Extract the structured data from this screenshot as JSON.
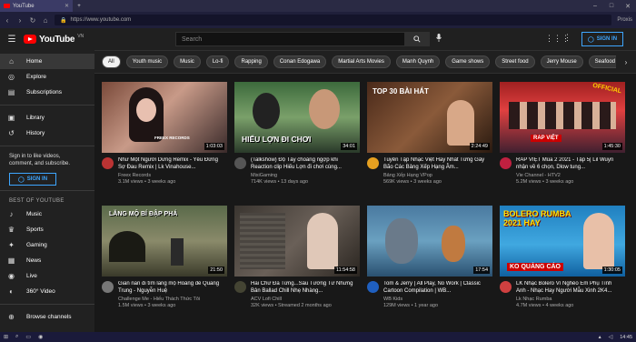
{
  "browser": {
    "tab_title": "YouTube",
    "url": "https://www.youtube.com",
    "extension_label": "Proxis"
  },
  "header": {
    "logo_text": "YouTube",
    "country_code": "VN",
    "search_placeholder": "Search",
    "signin_label": "SIGN IN"
  },
  "sidebar": {
    "main": [
      {
        "label": "Home",
        "icon": "home-icon"
      },
      {
        "label": "Explore",
        "icon": "compass-icon"
      },
      {
        "label": "Subscriptions",
        "icon": "subscriptions-icon"
      }
    ],
    "library": [
      {
        "label": "Library",
        "icon": "library-icon"
      },
      {
        "label": "History",
        "icon": "history-icon"
      }
    ],
    "signin_prompt": "Sign in to like videos, comment, and subscribe.",
    "signin_label": "SIGN IN",
    "best_heading": "BEST OF YOUTUBE",
    "best": [
      {
        "label": "Music",
        "icon": "music-icon"
      },
      {
        "label": "Sports",
        "icon": "trophy-icon"
      },
      {
        "label": "Gaming",
        "icon": "gamepad-icon"
      },
      {
        "label": "News",
        "icon": "news-icon"
      },
      {
        "label": "Live",
        "icon": "live-icon"
      },
      {
        "label": "360° Video",
        "icon": "360-icon"
      }
    ],
    "browse": {
      "label": "Browse channels",
      "icon": "plus-circle-icon"
    }
  },
  "chips": [
    "All",
    "Youth music",
    "Music",
    "Lo-fi",
    "Rapping",
    "Conan Edogawa",
    "Martial Arts Movies",
    "Manh Quynh",
    "Game shows",
    "Street food",
    "Jerry Mouse",
    "Seafood"
  ],
  "videos": [
    {
      "title": "Như Một Người Dưng Remix - Yêu Đừng Sợ Đau Remix | Lk Vinahouse...",
      "channel": "Freex Records",
      "stats": "3.1M views • 3 weeks ago",
      "duration": "1:03:03",
      "thumb_text": "",
      "thumb_badge": "FREEX RECORDS"
    },
    {
      "title": "(Talkshow) Độ Tày choáng ngợp khi Reaction clip Hiếu Lợn đi chơi cùng...",
      "channel": "MixiGaming",
      "stats": "714K views • 13 days ago",
      "duration": "34:01",
      "thumb_text": "HIẾU LỢN ĐI CHƠI",
      "thumb_badge": ""
    },
    {
      "title": "Tuyển Tập Nhạc Việt Hay Nhất Từng Gây Bão Các Bảng Xếp Hạng Âm...",
      "channel": "Bảng Xếp Hạng VPop",
      "stats": "569K views • 3 weeks ago",
      "duration": "2:24:49",
      "thumb_text": "TOP 30 BÀI HÁT",
      "thumb_badge": ""
    },
    {
      "title": "RAP VIỆT Mùa 2 2021 - Tập 5| Lil Wuyn nhận về 6 chọn, Dlow tung...",
      "channel": "Vie Channel - HTV2",
      "stats": "5.2M views • 3 weeks ago",
      "duration": "1:45:30",
      "thumb_text": "RAP VIỆT",
      "thumb_badge": "OFFICIAL"
    },
    {
      "title": "Gian nan đi tìm lăng mộ Hoàng đế Quang Trung - Nguyễn Huệ",
      "channel": "Challenge Me - Hiếu Thách Thức Tôi",
      "stats": "1.5M views • 3 weeks ago",
      "duration": "21:50",
      "thumb_text": "LĂNG MỘ BÍ ĐẬP PHÁ",
      "thumb_badge": ""
    },
    {
      "title": "Hai Chữ Đã Từng...Sầu Tương Tư Những Bản Ballad Chill Nhẹ Nhàng...",
      "channel": "ACV Lofi Chill",
      "stats": "32K views • Streamed 2 months ago",
      "duration": "11:54:58",
      "thumb_text": "",
      "thumb_badge": ""
    },
    {
      "title": "Tom & Jerry | All Play, No Work | Classic Cartoon Compilation | WB...",
      "channel": "WB Kids",
      "stats": "129M views • 1 year ago",
      "duration": "17:54",
      "thumb_text": "",
      "thumb_badge": ""
    },
    {
      "title": "LK Nhạc Bolero Vì Nghèo Em Phụ Tình Anh - Nhạc Hay Người Mẫu Xinh 2K4...",
      "channel": "Lk Nhạc Rumba",
      "stats": "4.7M views • 4 weeks ago",
      "duration": "1:30:05",
      "thumb_text": "BOLERO RUMBA 2021 HAY",
      "thumb_badge": "KO QUẢNG CÁO"
    }
  ],
  "taskbar": {
    "time": "14:45"
  },
  "colors": {
    "accent": "#3ea6ff",
    "brand_red": "#ff0000",
    "bg": "#181818"
  }
}
